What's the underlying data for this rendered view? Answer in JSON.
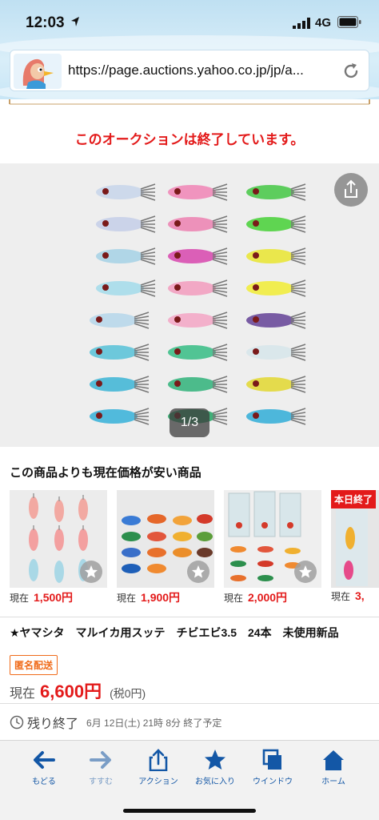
{
  "status_bar": {
    "time": "12:03",
    "network": "4G"
  },
  "browser": {
    "url": "https://page.auctions.yahoo.co.jp/jp/a..."
  },
  "notice": "このオークションは終了しています。",
  "gallery": {
    "counter": "1/3"
  },
  "cheaper_section": {
    "title": "この商品よりも現在価格が安い商品",
    "items": [
      {
        "price_label": "現在",
        "price": "1,500円"
      },
      {
        "price_label": "現在",
        "price": "1,900円"
      },
      {
        "price_label": "現在",
        "price": "2,000円"
      },
      {
        "price_label": "現在",
        "price": "3,",
        "badge": "本日終了"
      }
    ]
  },
  "item": {
    "title": "★ヤマシタ　マルイカ用スッテ　チビエビ3.5　24本　未使用新品",
    "badge": "匿名配送",
    "price_label": "現在",
    "price": "6,600円",
    "tax": "(税0円)",
    "remaining_label": "残り終了",
    "end_time": "6月 12日(土) 21時 8分 終了予定"
  },
  "toolbar": {
    "items": [
      {
        "label": "もどる",
        "icon": "back-arrow-icon"
      },
      {
        "label": "すすむ",
        "icon": "forward-arrow-icon"
      },
      {
        "label": "アクション",
        "icon": "share-icon"
      },
      {
        "label": "お気に入り",
        "icon": "star-icon"
      },
      {
        "label": "ウインドウ",
        "icon": "windows-icon"
      },
      {
        "label": "ホーム",
        "icon": "home-icon"
      }
    ]
  },
  "colors": {
    "accent_red": "#e31a1a",
    "toolbar_blue": "#1357a6",
    "badge_orange": "#f06b1a"
  }
}
